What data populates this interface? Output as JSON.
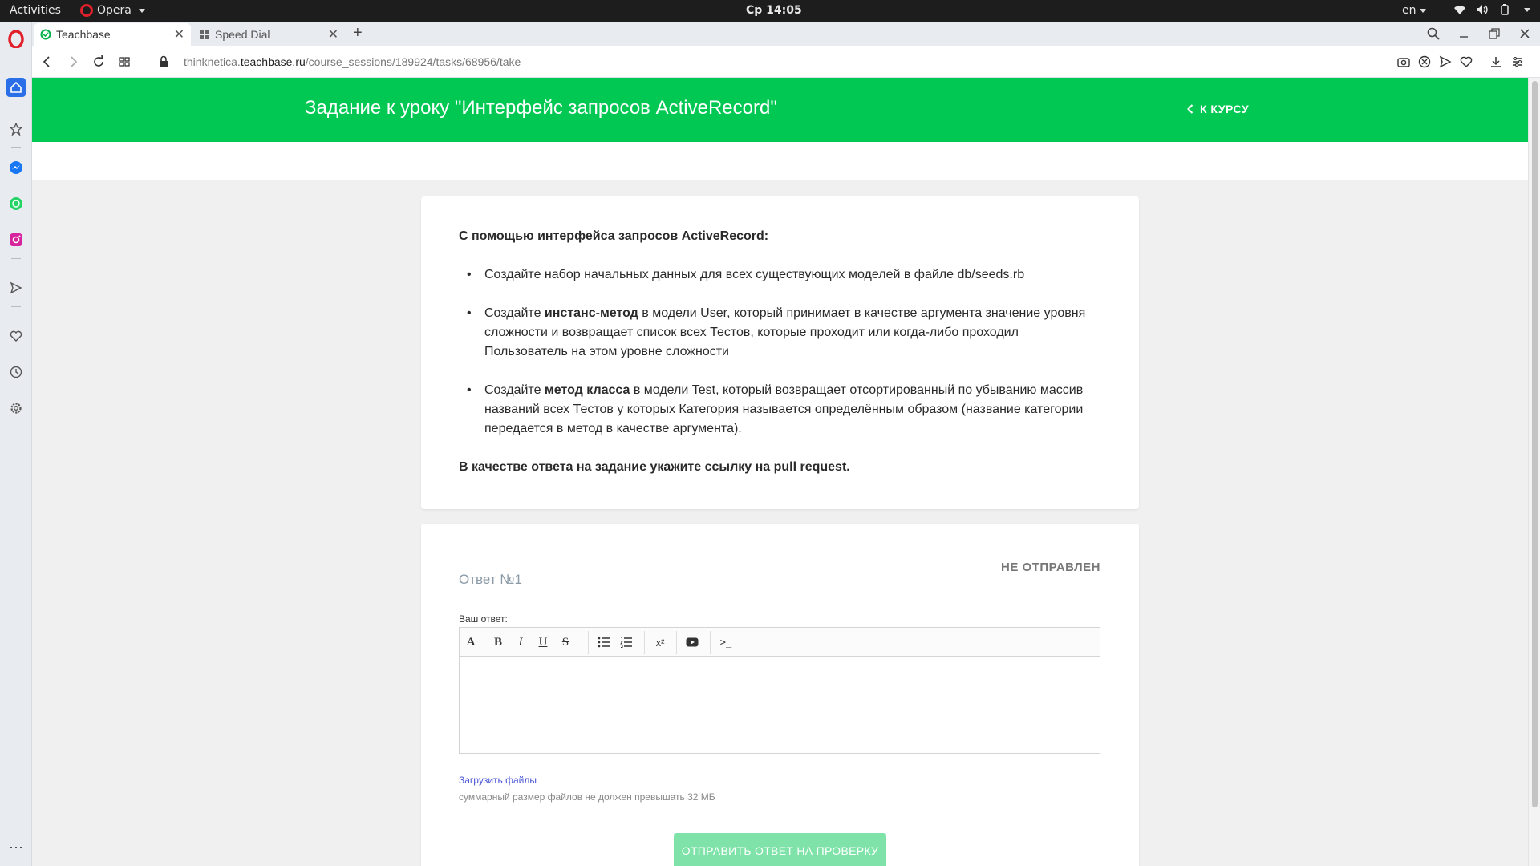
{
  "system_bar": {
    "activities": "Activities",
    "app_name": "Opera",
    "clock": "Ср 14:05",
    "language": "en"
  },
  "tabs": [
    {
      "title": "Teachbase",
      "active": true
    },
    {
      "title": "Speed Dial",
      "active": false
    }
  ],
  "address_bar": {
    "url_prefix": "thinknetica.",
    "url_host": "teachbase.ru",
    "url_path": "/course_sessions/189924/tasks/68956/take"
  },
  "hero": {
    "title": "Задание к уроку \"Интерфейс запросов ActiveRecord\"",
    "back_link": "К КУРСУ",
    "color": "#00c853"
  },
  "task": {
    "lead": "С помощью интерфейса запросов ActiveRecord:",
    "items": [
      {
        "pre": "Создайте набор начальных данных для всех существующих моделей в файле db/seeds.rb",
        "bold": "",
        "post": ""
      },
      {
        "pre": "Создайте ",
        "bold": "инстанс-метод",
        "post": " в модели User, который принимает в качестве аргумента значение уровня сложности и возвращает список всех Тестов, которые проходит или когда-либо проходил Пользователь на этом уровне сложности"
      },
      {
        "pre": "Создайте ",
        "bold": "метод класса",
        "post": " в модели Test, который возвращает отсортированный по убыванию массив названий всех Тестов у которых Категория называется определённым образом (название категории передается в метод в качестве аргумента)."
      }
    ],
    "final": "В качестве ответа на задание укажите ссылку на pull request."
  },
  "answer": {
    "title": "Ответ №1",
    "status": "НЕ ОТПРАВЛЕН",
    "label": "Ваш ответ:",
    "editor_value": "",
    "upload_link": "Загрузить файлы",
    "upload_note": "суммарный размер файлов не должен превышать 32 МБ",
    "submit_label": "ОТПРАВИТЬ ОТВЕТ НА ПРОВЕРКУ"
  },
  "editor_toolbar": {
    "font": "A",
    "bold": "B",
    "italic": "I",
    "underline": "U",
    "strike": "S",
    "superscript": "x²",
    "code": ">_"
  }
}
